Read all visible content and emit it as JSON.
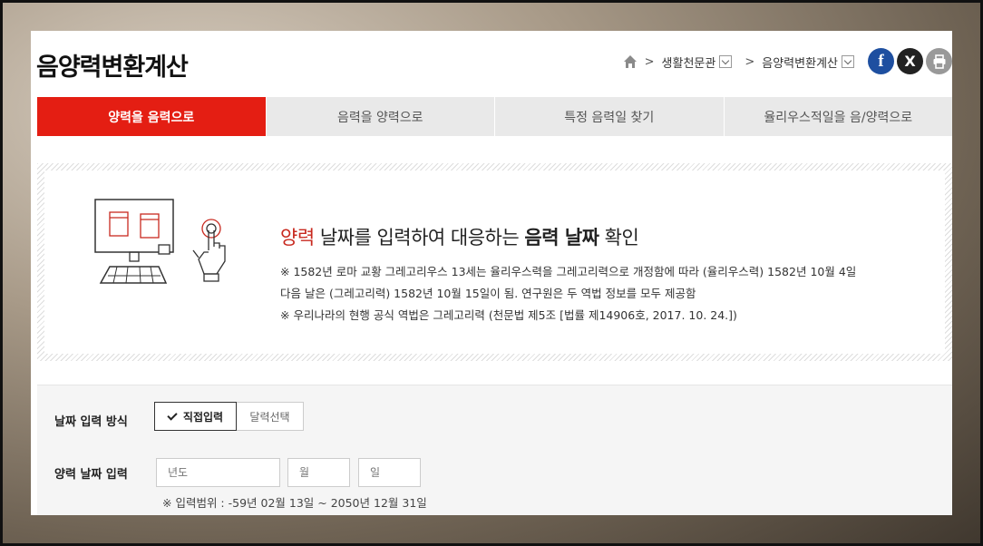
{
  "header": {
    "title": "음양력변환계산",
    "breadcrumb": [
      "생활천문관",
      "음양력변환계산"
    ]
  },
  "social": {
    "facebook": "f",
    "x": "X"
  },
  "tabs": [
    {
      "label": "양력을 음력으로",
      "active": true
    },
    {
      "label": "음력을 양력으로",
      "active": false
    },
    {
      "label": "특정 음력일 찾기",
      "active": false
    },
    {
      "label": "율리우스적일을 음/양력으로",
      "active": false
    }
  ],
  "info": {
    "headline_red": "양력",
    "headline_mid": " 날짜를 입력하여 대응하는 ",
    "headline_bold": "음력 날짜",
    "headline_end": " 확인",
    "notes": [
      "※ 1582년 로마 교황 그레고리우스 13세는 율리우스력을 그레고리력으로 개정함에 따라 (율리우스력) 1582년 10월 4일",
      "다음 날은 (그레고리력) 1582년 10월 15일이 됨. 연구원은 두 역법 정보를 모두 제공함",
      "※ 우리나라의 현행 공식 역법은 그레고리력 (천문법 제5조 [법률 제14906호, 2017. 10. 24.])"
    ]
  },
  "form": {
    "method_label": "날짜 입력 방식",
    "method_options": [
      "직접입력",
      "달력선택"
    ],
    "date_label": "양력 날짜 입력",
    "year_placeholder": "년도",
    "month_placeholder": "월",
    "day_placeholder": "일",
    "range_note": "※ 입력범위 : -59년 02월 13일 ~ 2050년 12월 31일"
  },
  "colors": {
    "accent": "#e41e13",
    "facebook": "#1e4fa0"
  }
}
